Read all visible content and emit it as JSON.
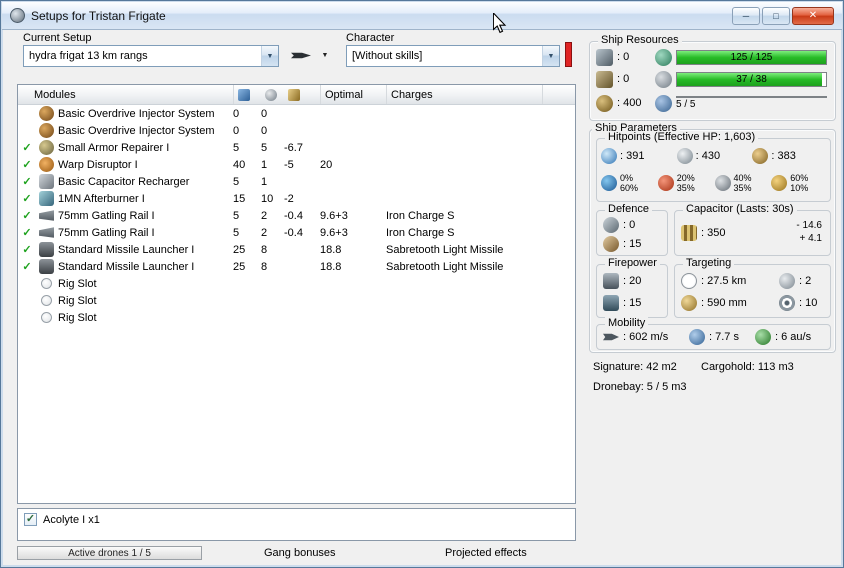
{
  "window": {
    "title": "Setups for Tristan Frigate"
  },
  "icons": {
    "minimize": "─",
    "maximize": "□",
    "close": "✕",
    "dropdown": "▼",
    "check": "✓"
  },
  "colors": {
    "bar_green": "#27bb27",
    "indicator_red": "#e02424",
    "check_green": "#1fa31f"
  },
  "toolbar": {
    "current_setup_label": "Current Setup",
    "current_setup_value": "hydra frigat 13 km rangs",
    "character_label": "Character",
    "character_value": "[Without skills]"
  },
  "modules_table": {
    "header": {
      "modules": "Modules",
      "optimal": "Optimal",
      "charges": "Charges"
    },
    "rows": [
      {
        "fitted": false,
        "icon": "overdrive-icon",
        "name": "Basic Overdrive Injector System",
        "cpu": "0",
        "pg": "0",
        "cap": "",
        "optimal": "",
        "charges": ""
      },
      {
        "fitted": false,
        "icon": "overdrive-icon",
        "name": "Basic Overdrive Injector System",
        "cpu": "0",
        "pg": "0",
        "cap": "",
        "optimal": "",
        "charges": ""
      },
      {
        "fitted": true,
        "icon": "armor-repairer-icon",
        "name": "Small Armor Repairer I",
        "cpu": "5",
        "pg": "5",
        "cap": "-6.7",
        "optimal": "",
        "charges": ""
      },
      {
        "fitted": true,
        "icon": "warp-disruptor-icon",
        "name": "Warp Disruptor I",
        "cpu": "40",
        "pg": "1",
        "cap": "-5",
        "optimal": "20",
        "charges": ""
      },
      {
        "fitted": true,
        "icon": "cap-recharger-icon",
        "name": "Basic Capacitor Recharger",
        "cpu": "5",
        "pg": "1",
        "cap": "",
        "optimal": "",
        "charges": ""
      },
      {
        "fitted": true,
        "icon": "afterburner-icon",
        "name": "1MN Afterburner I",
        "cpu": "15",
        "pg": "10",
        "cap": "-2",
        "optimal": "",
        "charges": ""
      },
      {
        "fitted": true,
        "icon": "railgun-icon",
        "name": "75mm Gatling Rail I",
        "cpu": "5",
        "pg": "2",
        "cap": "-0.4",
        "optimal": "9.6+3",
        "charges": "Iron Charge S"
      },
      {
        "fitted": true,
        "icon": "railgun-icon",
        "name": "75mm Gatling Rail I",
        "cpu": "5",
        "pg": "2",
        "cap": "-0.4",
        "optimal": "9.6+3",
        "charges": "Iron Charge S"
      },
      {
        "fitted": true,
        "icon": "missile-launcher-icon",
        "name": "Standard Missile Launcher I",
        "cpu": "25",
        "pg": "8",
        "cap": "",
        "optimal": "18.8",
        "charges": "Sabretooth Light Missile"
      },
      {
        "fitted": true,
        "icon": "missile-launcher-icon",
        "name": "Standard Missile Launcher I",
        "cpu": "25",
        "pg": "8",
        "cap": "",
        "optimal": "18.8",
        "charges": "Sabretooth Light Missile"
      },
      {
        "fitted": false,
        "icon": "rig-slot-icon",
        "name": "Rig Slot",
        "cpu": "",
        "pg": "",
        "cap": "",
        "optimal": "",
        "charges": ""
      },
      {
        "fitted": false,
        "icon": "rig-slot-icon",
        "name": "Rig Slot",
        "cpu": "",
        "pg": "",
        "cap": "",
        "optimal": "",
        "charges": ""
      },
      {
        "fitted": false,
        "icon": "rig-slot-icon",
        "name": "Rig Slot",
        "cpu": "",
        "pg": "",
        "cap": "",
        "optimal": "",
        "charges": ""
      }
    ]
  },
  "drones": {
    "items": [
      {
        "checked": true,
        "label": "Acolyte I x1"
      }
    ]
  },
  "bottom_bar": {
    "active_drones": "Active drones 1 / 5",
    "gang_bonuses": "Gang bonuses",
    "projected_effects": "Projected effects"
  },
  "ship_resources": {
    "title": "Ship Resources",
    "turret_hardpoints": ": 0",
    "launcher_hardpoints": ": 0",
    "calibration": ": 400",
    "cpu": {
      "text": "125 / 125",
      "pct": 100
    },
    "powergrid": {
      "text": "37 / 38",
      "pct": 97
    },
    "dronebay": {
      "text": "5 / 5",
      "pct": 100
    }
  },
  "ship_parameters": {
    "title": "Ship Parameters",
    "hitpoints": {
      "title": "Hitpoints (Effective HP: 1,603)",
      "shield": ": 391",
      "armor": ": 430",
      "structure": ": 383",
      "resists": [
        {
          "top": "0%",
          "bottom": "60%"
        },
        {
          "top": "20%",
          "bottom": "35%"
        },
        {
          "top": "40%",
          "bottom": "35%"
        },
        {
          "top": "60%",
          "bottom": "10%"
        }
      ]
    },
    "defence": {
      "title": "Defence",
      "shield_rate": ": 0",
      "armor_rate": ": 15"
    },
    "capacitor": {
      "title": "Capacitor (Lasts: 30s)",
      "capacity": ": 350",
      "usage": "- 14.6",
      "recharge": "+ 4.1"
    },
    "firepower": {
      "title": "Firepower",
      "turret_dps": ": 20",
      "missile_dps": ": 15"
    },
    "targeting": {
      "title": "Targeting",
      "range": ": 27.5 km",
      "max_targets": ": 2",
      "scan_resolution": ": 590 mm",
      "sensor_strength": ": 10"
    },
    "mobility": {
      "title": "Mobility",
      "max_velocity": ": 602 m/s",
      "align_time": ": 7.7 s",
      "warp_speed": ": 6 au/s"
    }
  },
  "footer_stats": {
    "signature": "Signature: 42 m2",
    "cargohold": "Cargohold: 113 m3",
    "dronebay": "Dronebay: 5 / 5 m3"
  }
}
